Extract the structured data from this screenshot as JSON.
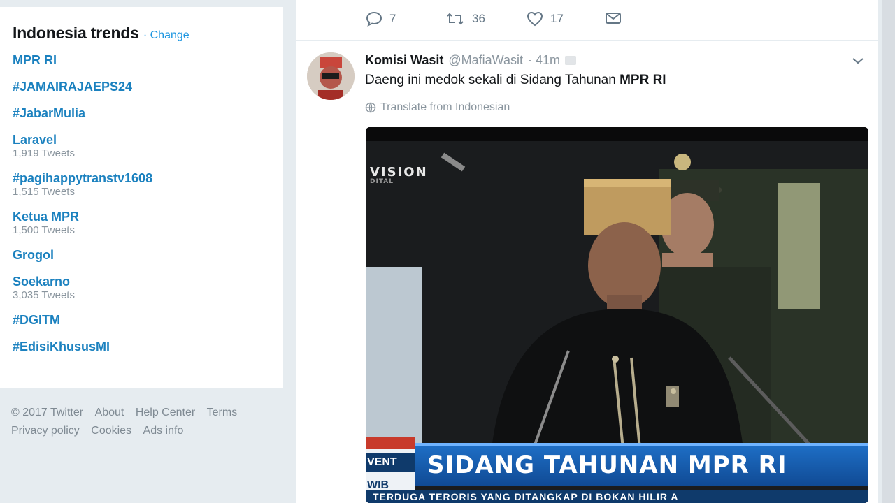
{
  "trends": {
    "title": "Indonesia trends",
    "change_label": "· Change",
    "items": [
      {
        "name": "MPR RI",
        "count": ""
      },
      {
        "name": "#JAMAIRAJAEPS24",
        "count": ""
      },
      {
        "name": "#JabarMulia",
        "count": ""
      },
      {
        "name": "Laravel",
        "count": "1,919 Tweets"
      },
      {
        "name": "#pagihappytranstv1608",
        "count": "1,515 Tweets"
      },
      {
        "name": "Ketua MPR",
        "count": "1,500 Tweets"
      },
      {
        "name": "Grogol",
        "count": ""
      },
      {
        "name": "Soekarno",
        "count": "3,035 Tweets"
      },
      {
        "name": "#DGITM",
        "count": ""
      },
      {
        "name": "#EdisiKhususMI",
        "count": ""
      }
    ]
  },
  "footer": {
    "copyright": "© 2017 Twitter",
    "about": "About",
    "help_center": "Help Center",
    "terms": "Terms",
    "privacy": "Privacy policy",
    "cookies": "Cookies",
    "ads_info": "Ads info"
  },
  "prev_tweet_actions": {
    "reply_count": "7",
    "retweet_count": "36",
    "like_count": "17"
  },
  "tweet": {
    "name": "Komisi Wasit",
    "handle": "@MafiaWasit",
    "time": "· 41m",
    "text_prefix": "Daeng ini medok sekali di Sidang Tahunan ",
    "text_bold": "MPR RI",
    "translate_label": "Translate from Indonesian"
  },
  "media": {
    "channel_logo": "VISION",
    "channel_sub": "DITAL",
    "event_label": "VENT",
    "wib_label": "WIB",
    "headline": "SIDANG TAHUNAN MPR RI",
    "ticker": "TERDUGA TERORIS YANG DITANGKAP DI BOKAN HILIR A"
  },
  "colors": {
    "link": "#1b81bf",
    "accent": "#1b95e0",
    "muted": "#8a959e",
    "background": "#e6ecf0"
  }
}
